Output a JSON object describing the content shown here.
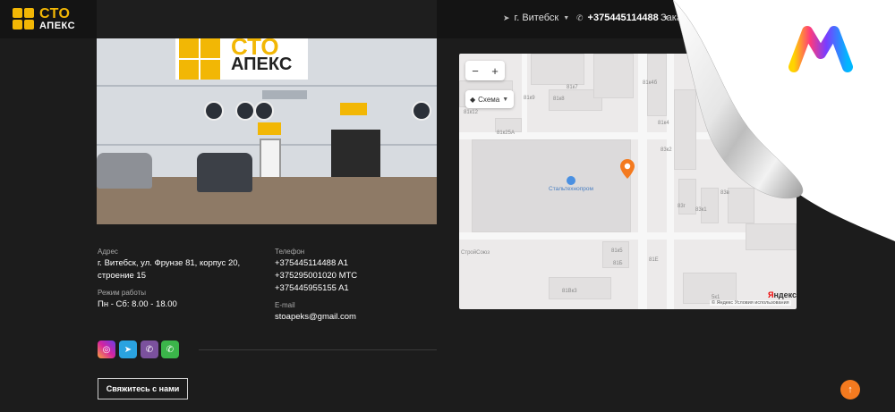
{
  "header": {
    "logo_main": "СТО",
    "logo_sub": "АПЕКС",
    "city": "г. Витебск",
    "phone": "+375445114488",
    "order_label": "Заказ"
  },
  "photo": {
    "sign_main": "СТО",
    "sign_sub": "АПЕКС"
  },
  "contacts": {
    "address_label": "Адрес",
    "address_value": "г. Витебск, ул. Фрунзе 81, корпус 20, строение 15",
    "hours_label": "Режим работы",
    "hours_value": "Пн - Сб: 8.00 - 18.00",
    "phone_label": "Телефон",
    "phones": [
      "+375445114488 A1",
      "+375295001020 МТС",
      "+375445955155 A1"
    ],
    "email_label": "E-mail",
    "email_value": "stoapeks@gmail.com"
  },
  "social": [
    {
      "name": "instagram",
      "glyph": "◎",
      "color": "#d6249f"
    },
    {
      "name": "telegram",
      "glyph": "➤",
      "color": "#2aa3e0"
    },
    {
      "name": "viber",
      "glyph": "✆",
      "color": "#7b519d"
    },
    {
      "name": "whatsapp",
      "glyph": "✆",
      "color": "#3bb54a"
    }
  ],
  "contact_button": "Свяжитесь с нами",
  "map": {
    "zoom_out": "−",
    "zoom_in": "+",
    "layer_label": "Схема",
    "poi_label": "Стальтехнопром",
    "labels": [
      "81к9",
      "81к7",
      "81к8",
      "81к12",
      "81к25А",
      "81к4б",
      "81к4",
      "83к2",
      "83в",
      "83г",
      "83к1",
      "81к5",
      "81Е",
      "81Б",
      "81Вк3",
      "5к1",
      "СтройСоюз"
    ],
    "logo_y": "Я",
    "logo_rest": "ндекс",
    "copyright": "© Яндекс  Условия использования"
  },
  "scroll_top_glyph": "↑"
}
